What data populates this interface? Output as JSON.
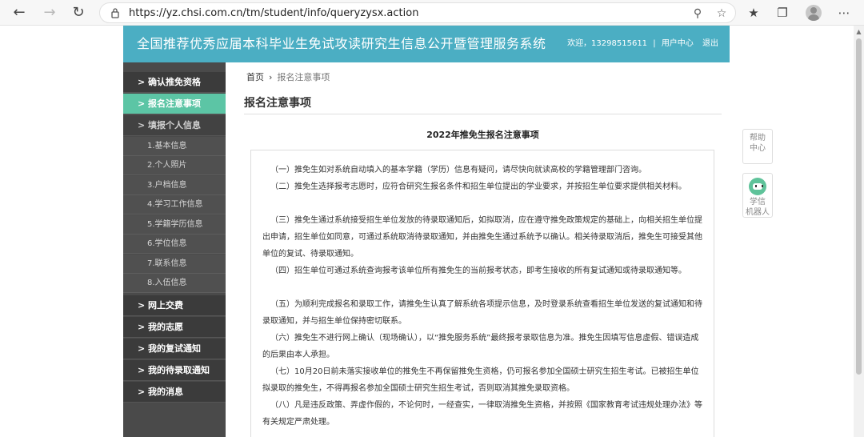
{
  "browser": {
    "url": "https://yz.chsi.com.cn/tm/student/info/queryzysx.action",
    "icons": [
      "back-arrow-icon",
      "forward-arrow-icon",
      "refresh-icon",
      "lock-icon",
      "zoom-icon",
      "favorite-add-icon",
      "favorites-icon",
      "collections-icon",
      "profile-icon",
      "more-icon"
    ]
  },
  "header": {
    "title": "全国推荐优秀应届本科毕业生免试攻读研究生信息公开暨管理服务系统",
    "greeting": "欢迎，13298515611",
    "user_center": "用户中心",
    "logout": "退出",
    "separator": "|"
  },
  "sidebar": {
    "items": [
      {
        "label": "> 确认推免资格"
      },
      {
        "label": "> 报名注意事项"
      },
      {
        "label": "> 填报个人信息"
      },
      {
        "label": "> 网上交费"
      },
      {
        "label": "> 我的志愿"
      },
      {
        "label": "> 我的复试通知"
      },
      {
        "label": "> 我的待录取通知"
      },
      {
        "label": "> 我的消息"
      }
    ],
    "subitems": [
      {
        "label": "1.基本信息"
      },
      {
        "label": "2.个人照片"
      },
      {
        "label": "3.户档信息"
      },
      {
        "label": "4.学习工作信息"
      },
      {
        "label": "5.学籍学历信息"
      },
      {
        "label": "6.学位信息"
      },
      {
        "label": "7.联系信息"
      },
      {
        "label": "8.入伍信息"
      }
    ]
  },
  "breadcrumb": {
    "home": "首页",
    "separator": "›",
    "current": "报名注意事项"
  },
  "page_title": "报名注意事项",
  "notice": {
    "heading": "2022年推免生报名注意事项",
    "paragraphs": [
      "（一）推免生如对系统自动填入的基本学籍（学历）信息有疑问，请尽快向就读高校的学籍管理部门咨询。",
      "（二）推免生选择报考志愿时，应符合研究生报名条件和招生单位提出的学业要求，并按招生单位要求提供相关材料。",
      "（三）推免生通过系统接受招生单位发放的待录取通知后，如拟取消，应在遵守推免政策规定的基础上，向相关招生单位提出申请，招生单位如同意，可通过系统取消待录取通知，并由推免生通过系统予以确认。相关待录取消后，推免生可接受其他单位的复试、待录取通知。",
      "（四）招生单位可通过系统查询报考该单位所有推免生的当前报考状态，即考生接收的所有复试通知或待录取通知等。",
      "（五）为顺利完成报名和录取工作，请推免生认真了解系统各项提示信息，及时登录系统查看招生单位发送的复试通知和待录取通知，并与招生单位保持密切联系。",
      "（六）推免生不进行网上确认（现场确认），以“推免服务系统”最终报考录取信息为准。推免生因填写信息虚假、错误造成的后果由本人承担。",
      "（七）10月20日前未落实接收单位的推免生不再保留推免生资格，仍可报名参加全国硕士研究生招生考试。已被招生单位拟录取的推免生，不得再报名参加全国硕士研究生招生考试，否则取消其推免录取资格。",
      "（八）凡是违反政策、弄虚作假的，不论何时，一经查实，一律取消推免生资格，并按照《国家教育考试违规处理办法》等有关规定严肃处理。"
    ]
  },
  "float": {
    "help_line1": "帮助",
    "help_line2": "中心",
    "robot_line1": "学信",
    "robot_line2": "机器人"
  }
}
